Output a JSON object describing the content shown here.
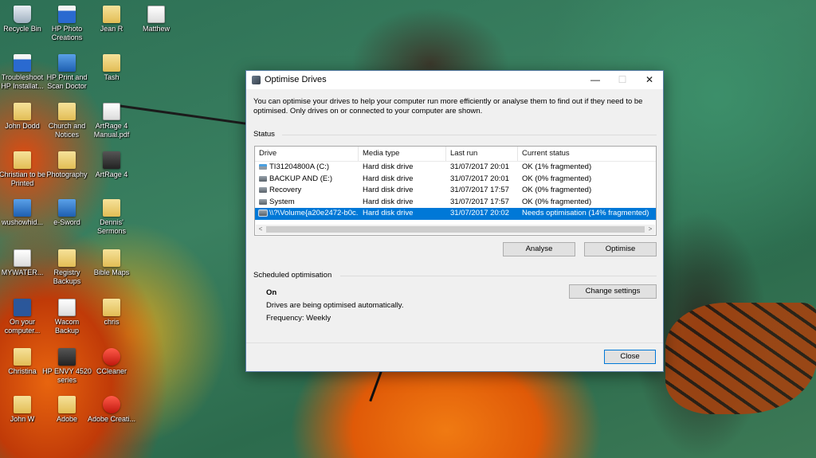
{
  "desktop": {
    "icons": [
      {
        "label": "Recycle Bin",
        "icon": "recycle-bin-icon"
      },
      {
        "label": "HP Photo Creations",
        "icon": "photo-app-icon"
      },
      {
        "label": "Jean R",
        "icon": "folder-icon"
      },
      {
        "label": "Matthew",
        "icon": "document-icon"
      },
      {
        "label": "Troubleshoot HP Installat...",
        "icon": "window-icon"
      },
      {
        "label": "HP Print and Scan Doctor",
        "icon": "printer-doctor-icon"
      },
      {
        "label": "Tash",
        "icon": "folder-icon"
      },
      {
        "label": "John Dodd",
        "icon": "folder-icon"
      },
      {
        "label": "Church and Notices",
        "icon": "folder-icon"
      },
      {
        "label": "ArtRage 4 Manual.pdf",
        "icon": "pdf-icon"
      },
      {
        "label": "Christian to be Printed",
        "icon": "folder-icon"
      },
      {
        "label": "Photography",
        "icon": "folder-icon"
      },
      {
        "label": "ArtRage 4",
        "icon": "artrage-icon"
      },
      {
        "label": "wushowhid...",
        "icon": "tool-icon"
      },
      {
        "label": "e-Sword",
        "icon": "esword-icon"
      },
      {
        "label": "Dennis' Sermons",
        "icon": "folder-icon"
      },
      {
        "label": "MYWATER...",
        "icon": "document-icon"
      },
      {
        "label": "Registry Backups",
        "icon": "folder-icon"
      },
      {
        "label": "Bible Maps",
        "icon": "folder-icon"
      },
      {
        "label": "On your computer...",
        "icon": "word-icon"
      },
      {
        "label": "Wacom Backup",
        "icon": "document-icon"
      },
      {
        "label": "chris",
        "icon": "folder-icon"
      },
      {
        "label": "Christina",
        "icon": "folder-icon"
      },
      {
        "label": "HP ENVY 4520 series",
        "icon": "printer-icon"
      },
      {
        "label": "CCleaner",
        "icon": "ccleaner-icon"
      },
      {
        "label": "John W",
        "icon": "folder-icon"
      },
      {
        "label": "Adobe",
        "icon": "folder-icon"
      },
      {
        "label": "Adobe Creati...",
        "icon": "adobe-icon"
      }
    ]
  },
  "window": {
    "title": "Optimise Drives",
    "minimize_glyph": "—",
    "maximize_glyph": "☐",
    "close_glyph": "✕",
    "intro": "You can optimise your drives to help your computer run more efficiently or analyse them to find out if they need to be optimised. Only drives on or connected to your computer are shown.",
    "status_label": "Status",
    "columns": [
      "Drive",
      "Media type",
      "Last run",
      "Current status"
    ],
    "drives": [
      {
        "drive": "TI31204800A (C:)",
        "media": "Hard disk drive",
        "last_run": "31/07/2017 20:01",
        "status": "OK (1% fragmented)",
        "icon": "system-drive-icon",
        "selected": false
      },
      {
        "drive": "BACKUP AND  (E:)",
        "media": "Hard disk drive",
        "last_run": "31/07/2017 20:01",
        "status": "OK (0% fragmented)",
        "icon": "hard-drive-icon",
        "selected": false
      },
      {
        "drive": "Recovery",
        "media": "Hard disk drive",
        "last_run": "31/07/2017 17:57",
        "status": "OK (0% fragmented)",
        "icon": "hard-drive-icon",
        "selected": false
      },
      {
        "drive": "System",
        "media": "Hard disk drive",
        "last_run": "31/07/2017 17:57",
        "status": "OK (0% fragmented)",
        "icon": "hard-drive-icon",
        "selected": false
      },
      {
        "drive": "\\\\?\\Volume{a20e2472-b0c...",
        "media": "Hard disk drive",
        "last_run": "31/07/2017 20:02",
        "status": "Needs optimisation (14% fragmented)",
        "icon": "hard-drive-icon",
        "selected": true
      }
    ],
    "scroll_left_glyph": "<",
    "scroll_right_glyph": ">",
    "analyse_label": "Analyse",
    "optimise_label": "Optimise",
    "scheduled_label": "Scheduled optimisation",
    "change_settings_label": "Change settings",
    "schedule_state": "On",
    "schedule_desc": "Drives are being optimised automatically.",
    "schedule_frequency": "Frequency: Weekly",
    "close_label": "Close"
  }
}
